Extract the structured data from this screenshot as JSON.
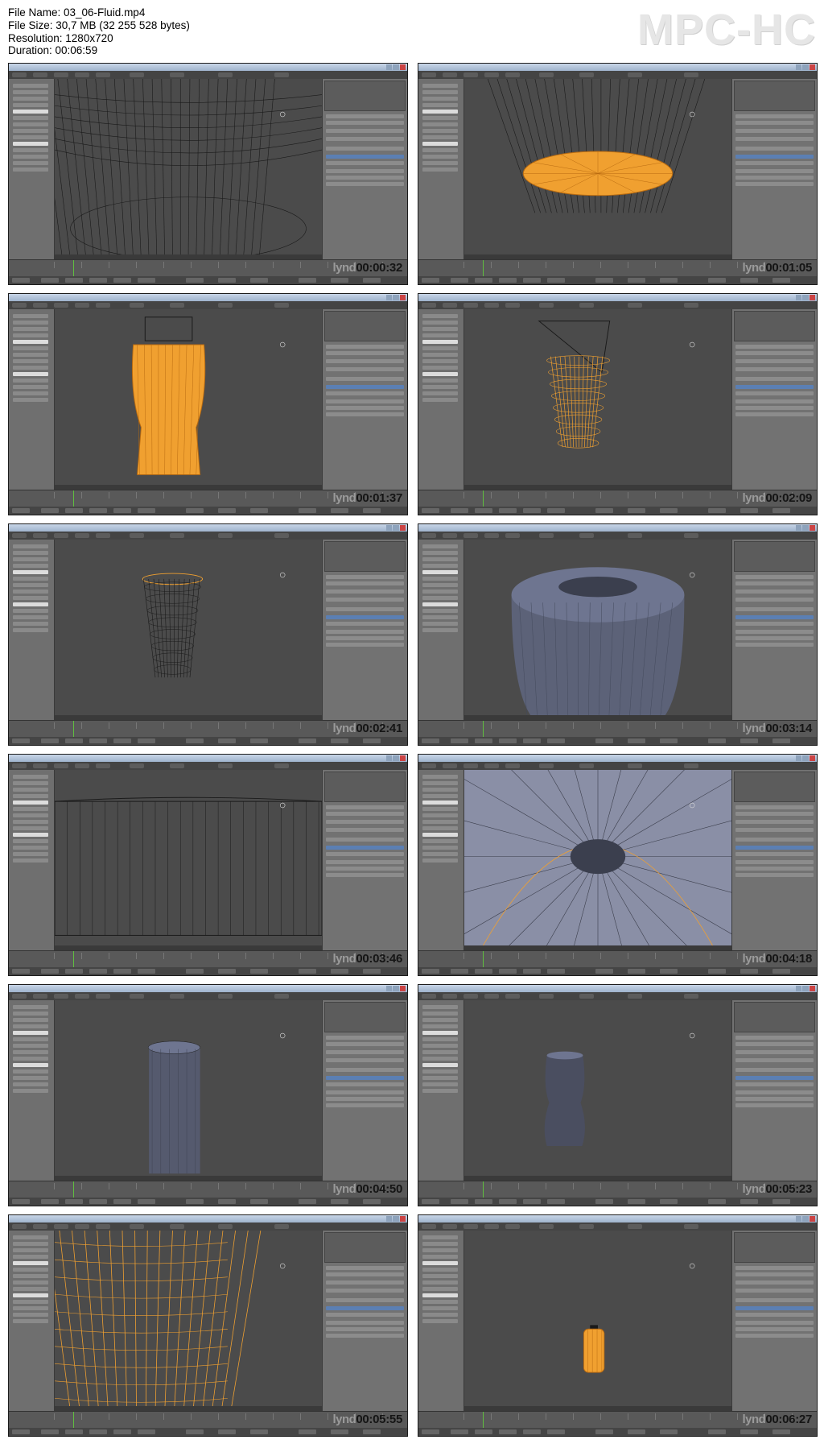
{
  "file_info": {
    "file_name": "File Name: 03_06-Fluid.mp4",
    "file_size": "File Size: 30,7 MB (32 255 528 bytes)",
    "resolution": "Resolution: 1280x720",
    "duration": "Duration: 00:06:59"
  },
  "player_logo": "MPC-HC",
  "watermark_brand": "lynd",
  "thumbnails": [
    {
      "time": "00:00:32",
      "scene": "wire-bowl"
    },
    {
      "time": "00:01:05",
      "scene": "orange-disc"
    },
    {
      "time": "00:01:37",
      "scene": "orange-bottle"
    },
    {
      "time": "00:02:09",
      "scene": "orange-wire-bottle"
    },
    {
      "time": "00:02:41",
      "scene": "dark-wire-bottle"
    },
    {
      "time": "00:03:14",
      "scene": "solid-top"
    },
    {
      "time": "00:03:46",
      "scene": "wire-side"
    },
    {
      "time": "00:04:18",
      "scene": "solid-closeup"
    },
    {
      "time": "00:04:50",
      "scene": "solid-neck"
    },
    {
      "time": "00:05:23",
      "scene": "small-bottle"
    },
    {
      "time": "00:05:55",
      "scene": "orange-closeup"
    },
    {
      "time": "00:06:27",
      "scene": "tiny-orange"
    }
  ],
  "colors": {
    "selection_orange": "#f0a030",
    "wire_dark": "#1a1a1a",
    "ui_blue": "#5b7fb3",
    "viewport_bg": "#4b4b4b"
  }
}
